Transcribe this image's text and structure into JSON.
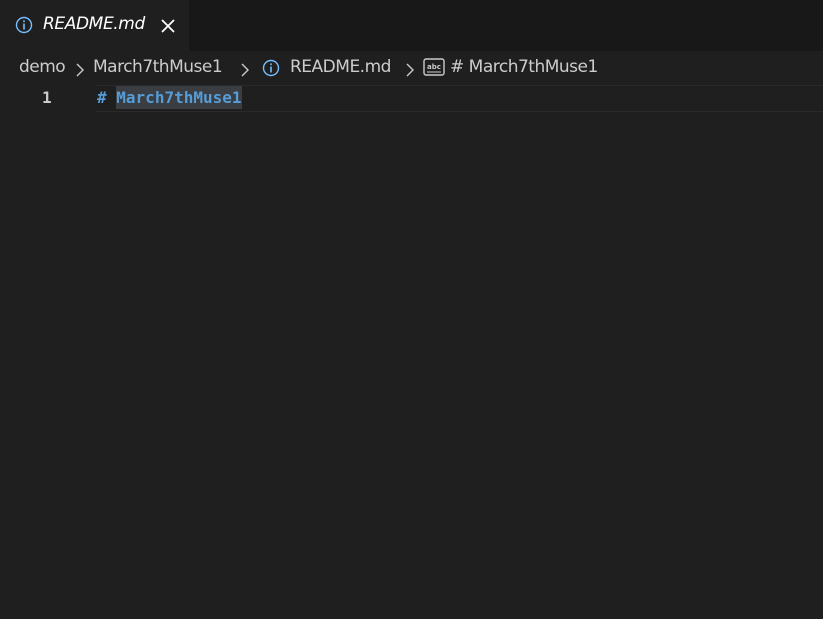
{
  "tab": {
    "label": "README.md",
    "icon": "info-icon",
    "close_icon": "close-icon"
  },
  "breadcrumb": {
    "items": [
      "demo",
      "March7thMuse1",
      "README.md",
      "# March7thMuse1"
    ],
    "icons": [
      "chevron-right-icon",
      "info-icon",
      "string-symbol-icon"
    ]
  },
  "editor": {
    "line_number": "1",
    "line_hash": "#",
    "line_heading": "March7thMuse1"
  },
  "colors": {
    "background": "#1f1f1f",
    "tabbar": "#181818",
    "keyword": "#569cd6",
    "selection": "#3a3d41",
    "text": "#cccccc",
    "info_icon": "#75beff"
  }
}
